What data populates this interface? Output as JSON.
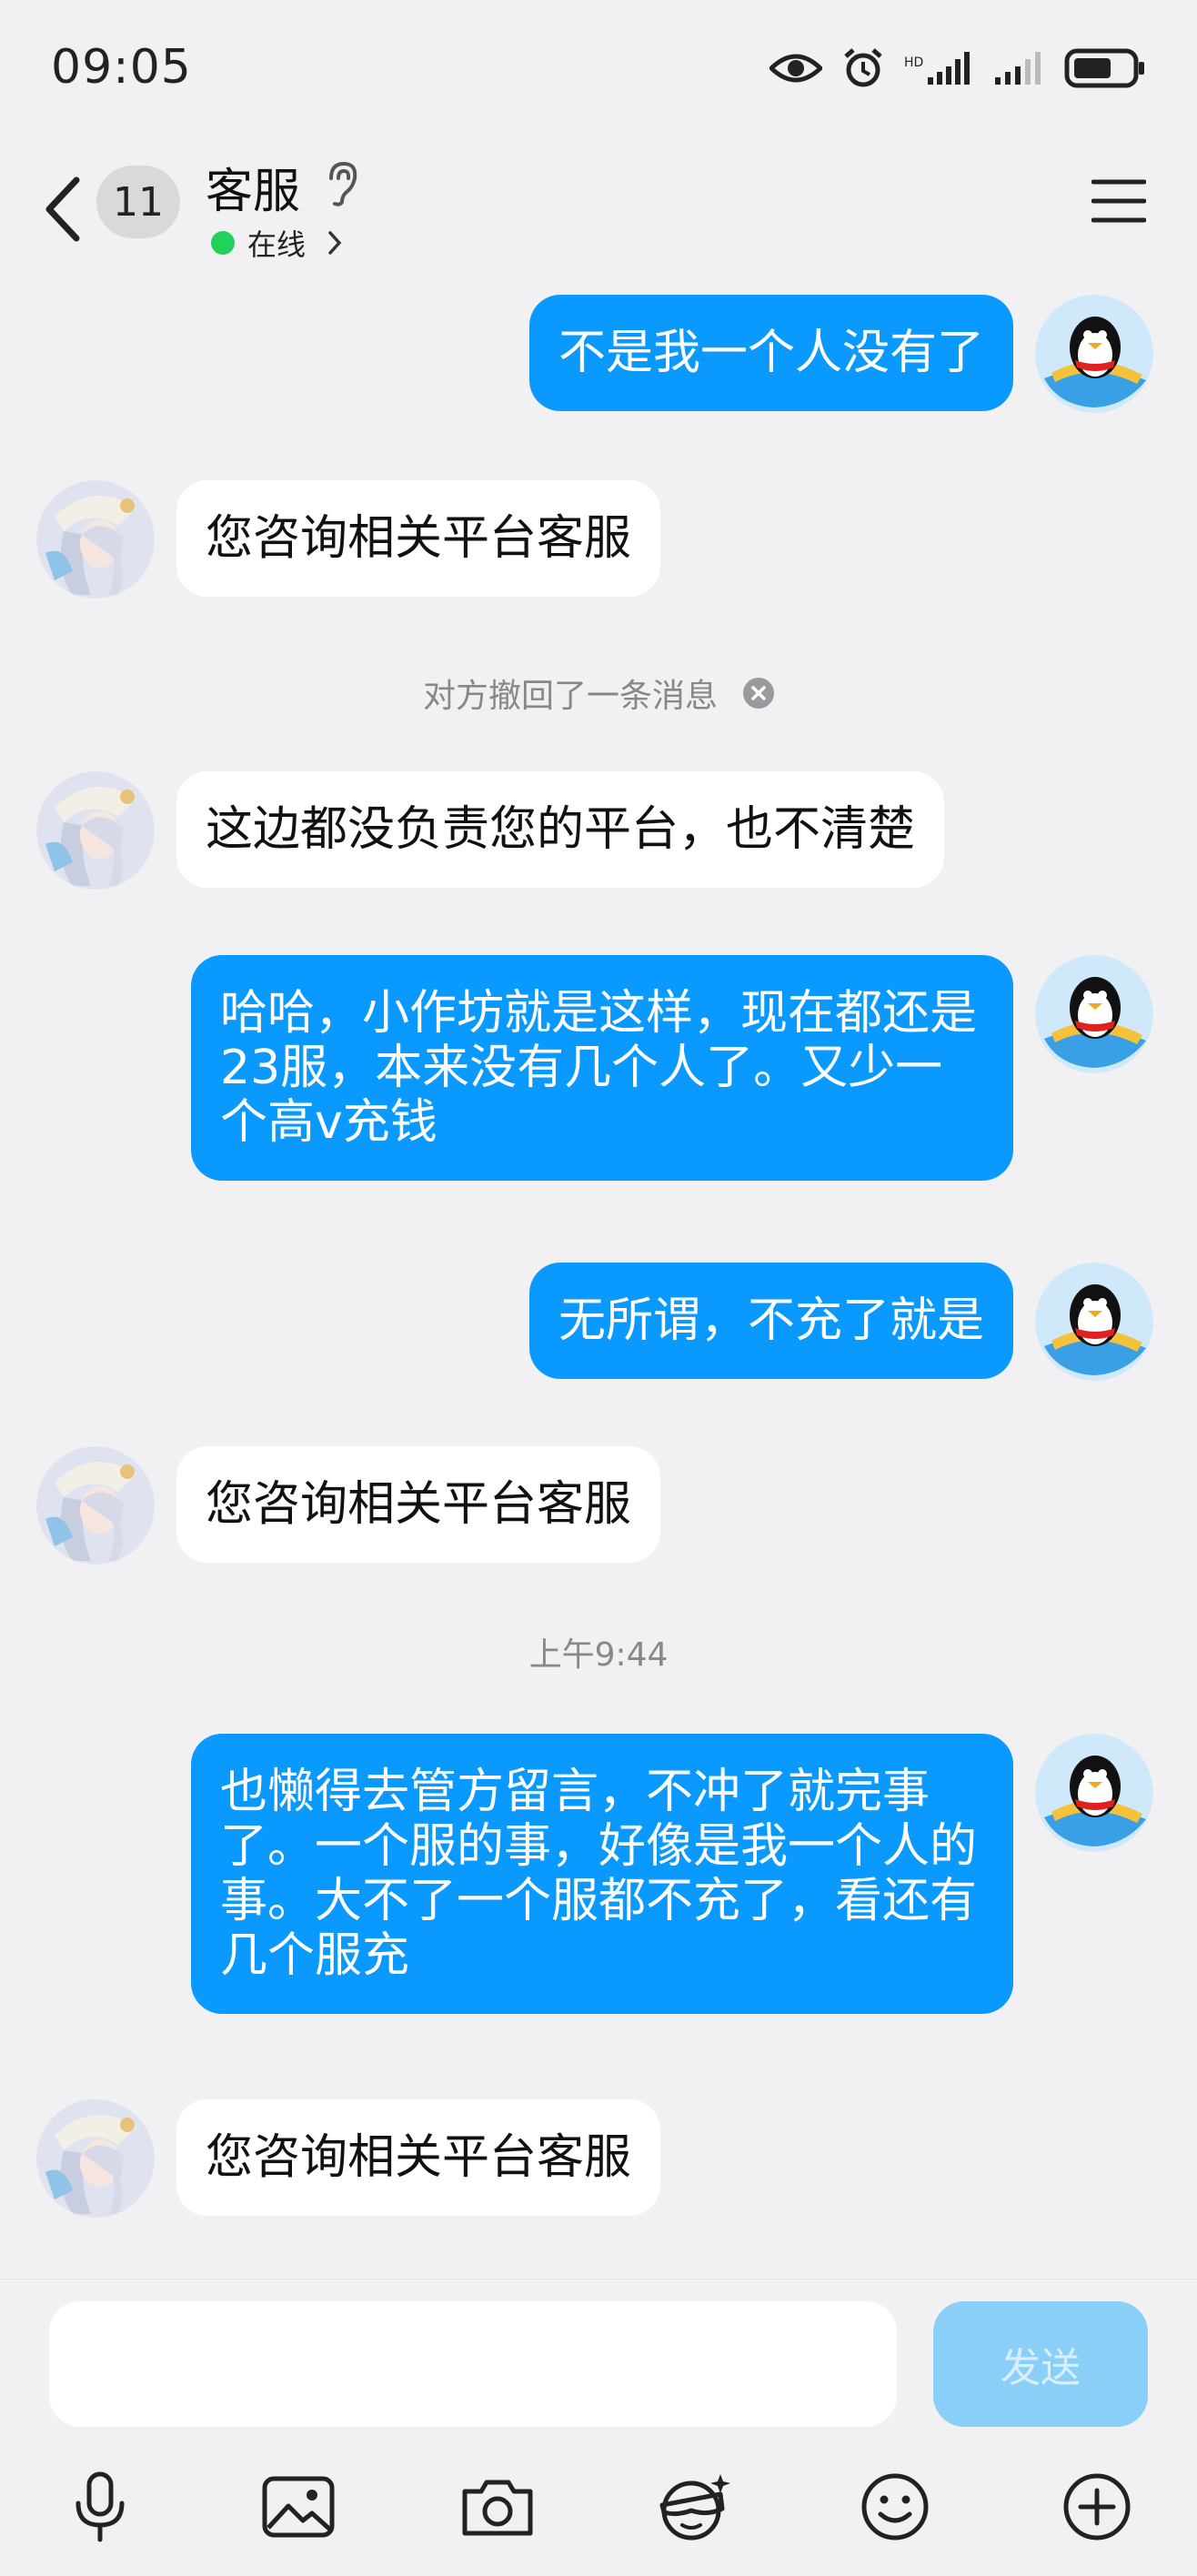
{
  "status_bar": {
    "time": "09:05",
    "icons": [
      "eye-icon",
      "alarm-icon",
      "signal-icon",
      "signal-icon",
      "battery-icon"
    ]
  },
  "header": {
    "unread_count": "11",
    "contact_name": "客服",
    "online_status": "在线"
  },
  "messages": [
    {
      "side": "out",
      "text": "不是我一个人没有了"
    },
    {
      "side": "in",
      "text": "您咨询相关平台客服"
    },
    {
      "side": "system",
      "text": "对方撤回了一条消息"
    },
    {
      "side": "in",
      "text": "这边都没负责您的平台，也不清楚"
    },
    {
      "side": "out",
      "text": "哈哈，小作坊就是这样，现在都还是23服，本来没有几个人了。又少一个高v充钱"
    },
    {
      "side": "out",
      "text": "无所谓，不充了就是"
    },
    {
      "side": "in",
      "text": "您咨询相关平台客服"
    },
    {
      "side": "timestamp",
      "text": "上午9:44"
    },
    {
      "side": "out",
      "text": "也懒得去管方留言，不冲了就完事了。一个服的事，好像是我一个人的事。大不了一个服都不充了，看还有几个服充"
    },
    {
      "side": "in",
      "text": "您咨询相关平台客服"
    }
  ],
  "input": {
    "value": "",
    "send_label": "发送"
  },
  "toolbar": [
    "microphone-icon",
    "image-icon",
    "camera-icon",
    "face-effect-icon",
    "emoji-icon",
    "plus-icon"
  ],
  "colors": {
    "outgoing_bubble": "#0a99ff",
    "incoming_bubble": "#ffffff",
    "background": "#f1f1f3",
    "online": "#22d15c",
    "send_disabled": "#89cff8"
  }
}
